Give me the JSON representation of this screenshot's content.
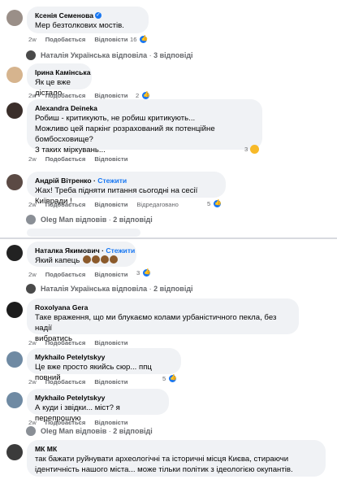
{
  "comments": [
    {
      "author": "Ксенія Семенова",
      "text": [
        "Мер безтолкових мостів."
      ],
      "time": "2w",
      "like": "Подобається",
      "reply": "Відповісти",
      "reactions": "16"
    },
    {
      "author": "Ірина Камінська",
      "text": [
        "Як це вже дістало"
      ],
      "time": "2w",
      "like": "Подобається",
      "reply": "Відповісти",
      "reactions": "2"
    },
    {
      "author": "Alexandra Deineka",
      "text": [
        "Робиш - критикують, не робиш критикують...",
        "Можливо цей паркінг розрахований як потенційне бомбосховище?",
        "З таких міркувань..."
      ],
      "time": "2w",
      "like": "Подобається",
      "reply": "Відповісти",
      "reactions": "3"
    },
    {
      "author": "Андрій Вітренко",
      "follow": "Стежити",
      "text": [
        "Жах! Треба підняти питання сьогодні на сесії Київради !"
      ],
      "time": "2w",
      "like": "Подобається",
      "reply": "Відповісти",
      "edited": "Відредаговано",
      "reactions": "5"
    },
    {
      "author": "Наталка Якимович",
      "follow": "Стежити",
      "text": [
        "Який капець"
      ],
      "time": "2w",
      "like": "Подобається",
      "reply": "Відповісти",
      "reactions": "3"
    },
    {
      "author": "Roxolyana Gera",
      "text": [
        "Таке враження, що ми блукаємо колами урбаністичного пекла, без надії",
        "вибратись"
      ],
      "time": "2w",
      "like": "Подобається",
      "reply": "Відповісти"
    },
    {
      "author": "Mykhailo Petelytskyy",
      "text": [
        "Це вже просто якийсь сюр... ппц повний"
      ],
      "time": "2w",
      "like": "Подобається",
      "reply": "Відповісти",
      "reactions": "5"
    },
    {
      "author": "Mykhailo Petelytskyy",
      "text": [
        "А куди і звідки... міст? я перепрошую"
      ],
      "time": "2w",
      "like": "Подобається",
      "reply": "Відповісти"
    },
    {
      "author": "МК МК",
      "text": [
        "так бажати руйнувати археологічні та історичні місця Києва, стираючи",
        "ідентичність нашого міста... може тільки політик з ідеологією окупантів."
      ]
    }
  ],
  "replies": [
    {
      "name": "Наталія Українська відповіла",
      "count": "3 відповіді"
    },
    {
      "name": "Oleg Man відповів",
      "count": "2 відповіді"
    },
    {
      "name": "Наталія Українська відповіла",
      "count": "2 відповіді"
    },
    {
      "name": "Oleg Man відповів",
      "count": "2 відповіді"
    }
  ],
  "colors": {
    "accent": "#1877f2",
    "bubble": "#f0f2f5",
    "muted": "#65676b"
  }
}
